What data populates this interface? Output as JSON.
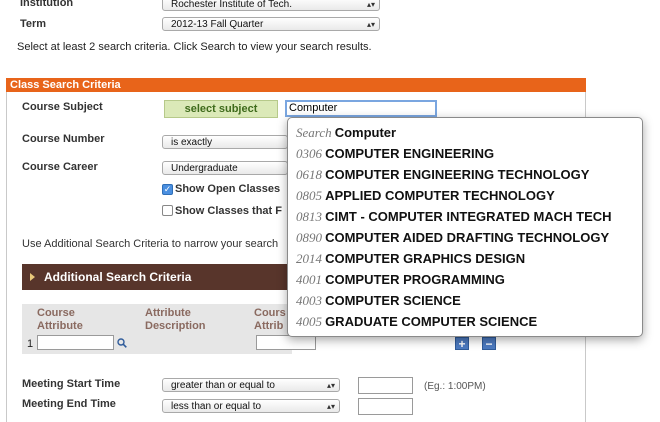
{
  "top": {
    "institution_label": "Institution",
    "institution_value": "Rochester Institute of Tech.",
    "term_label": "Term",
    "term_value": "2012-13 Fall Quarter",
    "instructions": "Select at least 2 search criteria. Click Search to view your search results."
  },
  "panel": {
    "title": "Class Search Criteria",
    "course_subject_label": "Course Subject",
    "select_subject_button": "select subject",
    "subject_input_value": "Computer",
    "course_number_label": "Course Number",
    "course_number_op": "is exactly",
    "course_career_label": "Course Career",
    "course_career_value": "Undergraduate",
    "show_open_label": "Show Open Classes",
    "show_open_checked": true,
    "show_classes_label": "Show Classes that F",
    "additional_hint": "Use Additional Search Criteria to narrow your search"
  },
  "additional": {
    "bar_label": "Additional Search Criteria",
    "col1": [
      "Course",
      "Attribute"
    ],
    "col2": [
      "Attribute",
      "Description"
    ],
    "col3": [
      "Cours",
      "Attrib"
    ],
    "row_number": "1",
    "add_button": "+",
    "remove_button": "−",
    "meeting_start_label": "Meeting Start Time",
    "meeting_start_op": "greater than or equal to",
    "meeting_end_label": "Meeting End Time",
    "meeting_end_op": "less than or equal to",
    "time_example": "(Eg.: 1:00PM)"
  },
  "autocomplete": {
    "search_prefix": "Search",
    "search_term": "Computer",
    "items": [
      {
        "code": "0306",
        "name": "COMPUTER ENGINEERING"
      },
      {
        "code": "0618",
        "name": "COMPUTER ENGINEERING TECHNOLOGY"
      },
      {
        "code": "0805",
        "name": "APPLIED COMPUTER TECHNOLOGY"
      },
      {
        "code": "0813",
        "name": "CIMT - COMPUTER INTEGRATED MACH TECH"
      },
      {
        "code": "0890",
        "name": "COMPUTER AIDED DRAFTING TECHNOLOGY"
      },
      {
        "code": "2014",
        "name": "COMPUTER GRAPHICS DESIGN"
      },
      {
        "code": "4001",
        "name": "COMPUTER PROGRAMMING"
      },
      {
        "code": "4003",
        "name": "COMPUTER SCIENCE"
      },
      {
        "code": "4005",
        "name": "GRADUATE COMPUTER SCIENCE"
      }
    ]
  },
  "colors": {
    "accent_orange": "#e8641a",
    "header_brown": "#58352b",
    "button_green": "#dbe9b8"
  }
}
